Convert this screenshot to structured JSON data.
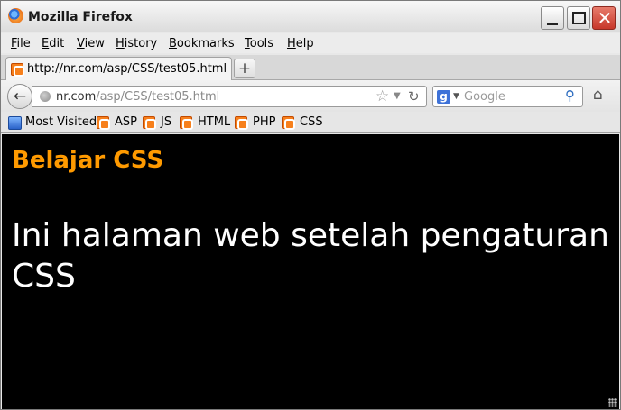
{
  "window": {
    "title": "Mozilla Firefox",
    "logo_icon": "firefox-logo-icon",
    "controls": {
      "minimize_icon": "minimize-icon",
      "maximize_icon": "maximize-icon",
      "close_icon": "close-icon"
    }
  },
  "menu": {
    "items": [
      {
        "label": "File",
        "accel": "F",
        "rest": "ile"
      },
      {
        "label": "Edit",
        "accel": "E",
        "rest": "dit"
      },
      {
        "label": "View",
        "accel": "V",
        "rest": "iew"
      },
      {
        "label": "History",
        "accel": "H",
        "rest": "istory"
      },
      {
        "label": "Bookmarks",
        "accel": "B",
        "rest": "ookmarks"
      },
      {
        "label": "Tools",
        "accel": "T",
        "rest": "ools"
      },
      {
        "label": "Help",
        "accel": "H",
        "rest": "elp"
      }
    ]
  },
  "tabs": [
    {
      "label": "http://nr.com/asp/CSS/test05.html",
      "icon": "xampp-icon"
    }
  ],
  "new_tab_symbol": "+",
  "navbar": {
    "back_symbol": "←",
    "url_host": "nr.com",
    "url_path": "/asp/CSS/test05.html",
    "star_symbol": "☆",
    "dropdown_symbol": "▼",
    "reload_symbol": "↻",
    "search_engine_symbol": "g",
    "search_dropdown_symbol": "▼",
    "search_placeholder": "Google",
    "search_symbol": "⚲",
    "home_symbol": "⌂"
  },
  "bookmarks": [
    {
      "label": "Most Visited",
      "icon": "most-visited-icon"
    },
    {
      "label": "ASP",
      "icon": "xampp-icon"
    },
    {
      "label": "JS",
      "icon": "xampp-icon"
    },
    {
      "label": "HTML",
      "icon": "xampp-icon"
    },
    {
      "label": "PHP",
      "icon": "xampp-icon"
    },
    {
      "label": "CSS",
      "icon": "xampp-icon"
    }
  ],
  "page": {
    "heading": "Belajar CSS",
    "paragraph": "Ini halaman web setelah pengaturan CSS",
    "background_color": "#000000",
    "heading_color": "#ff9a00",
    "text_color": "#ffffff"
  },
  "colors": {
    "accent_orange": "#f7801c",
    "window_bg": "#e8e8e8"
  }
}
